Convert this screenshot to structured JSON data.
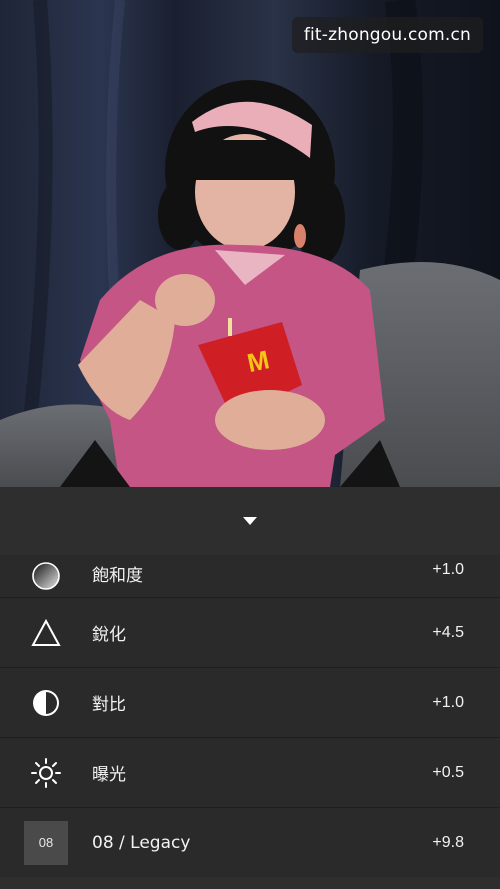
{
  "photo": {
    "alt": "portrait-photo",
    "watermark": "fit-zhongou.com.cn"
  },
  "panel": {
    "collapse_icon": "chevron-down-icon",
    "adjustments": [
      {
        "label": "飽和度",
        "value": "+1.0",
        "icon": "saturation-icon"
      },
      {
        "label": "銳化",
        "value": "+4.5",
        "icon": "sharpen-icon"
      },
      {
        "label": "對比",
        "value": "+1.0",
        "icon": "contrast-icon"
      },
      {
        "label": "曝光",
        "value": "+0.5",
        "icon": "exposure-icon"
      },
      {
        "label": "08 / Legacy",
        "value": "+9.8",
        "icon": "filter-badge",
        "badge": "08"
      }
    ]
  },
  "colors": {
    "panel_bg": "#2e2e2e",
    "row_bg": "#2a2a2a",
    "text": "#f2f2f2",
    "badge_bg": "#4a4a4a"
  }
}
